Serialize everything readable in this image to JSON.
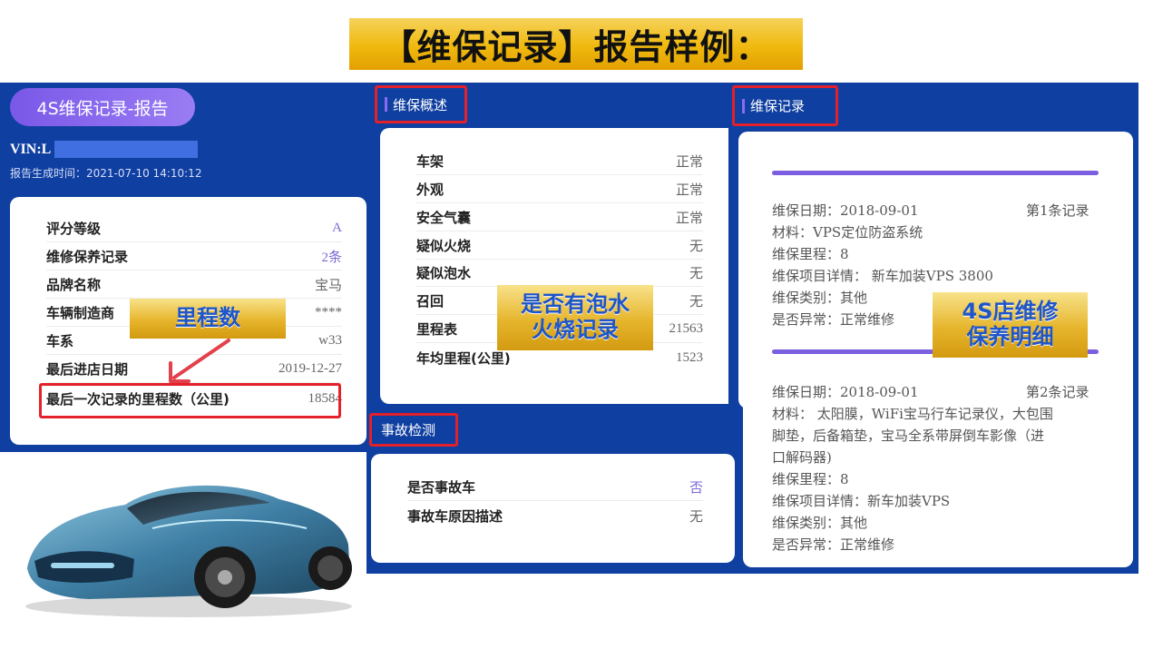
{
  "title": "【维保记录】报告样例：",
  "left": {
    "pill": "4S维保记录-报告",
    "vin_label": "VIN:L",
    "report_time": "报告生成时间：2021-07-10 14:10:12",
    "rows": [
      {
        "label": "评分等级",
        "value": "A"
      },
      {
        "label": "维修保养记录",
        "value": "2条"
      },
      {
        "label": "品牌名称",
        "value": "宝马"
      },
      {
        "label": "车辆制造商",
        "value": "****"
      },
      {
        "label": "车系",
        "value": "w33"
      },
      {
        "label": "最后进店日期",
        "value": "2019-12-27"
      },
      {
        "label": "最后一次记录的里程数（公里)",
        "value": "18584"
      }
    ],
    "mileage_tag": "里程数"
  },
  "overview": {
    "tag": "维保概述",
    "rows": [
      {
        "label": "车架",
        "value": "正常"
      },
      {
        "label": "外观",
        "value": "正常"
      },
      {
        "label": "安全气囊",
        "value": "正常"
      },
      {
        "label": "疑似火烧",
        "value": "无"
      },
      {
        "label": "疑似泡水",
        "value": "无"
      },
      {
        "label": "召回",
        "value": "无"
      },
      {
        "label": "里程表",
        "value": "21563"
      },
      {
        "label": "年均里程(公里)",
        "value": "1523"
      }
    ],
    "flood_tag_line1": "是否有泡水",
    "flood_tag_line2": "火烧记录"
  },
  "accident": {
    "tag": "事故检测",
    "rows": [
      {
        "label": "是否事故车",
        "value": "否"
      },
      {
        "label": "事故车原因描述",
        "value": "无"
      }
    ]
  },
  "records": {
    "tag": "维保记录",
    "detail_tag_line1": "4S店维修",
    "detail_tag_line2": "保养明细",
    "items": [
      {
        "date": "维保日期：2018-09-01",
        "index": "第1条记录",
        "material": "材料：VPS定位防盗系统",
        "mileage": "维保里程：8",
        "project": "维保项目详情：  新车加装VPS 3800",
        "category": "维保类别：其他",
        "abnormal": "是否异常：正常维修"
      },
      {
        "date": "维保日期：2018-09-01",
        "index": "第2条记录",
        "material_l1": "材料：  太阳膜，WiFi宝马行车记录仪，大包围",
        "material_l2": "脚垫，后备箱垫，宝马全系带屏倒车影像（进",
        "material_l3": "口解码器)",
        "mileage": "维保里程：8",
        "project": "维保项目详情：新车加装VPS",
        "category": "维保类别：其他",
        "abnormal": "是否异常：正常维修"
      }
    ]
  },
  "colors": {
    "panel_blue": "#0f3fa0",
    "accent_purple": "#7b5fe0",
    "highlight_red": "#e4202a",
    "gold": "#f0b90f"
  }
}
